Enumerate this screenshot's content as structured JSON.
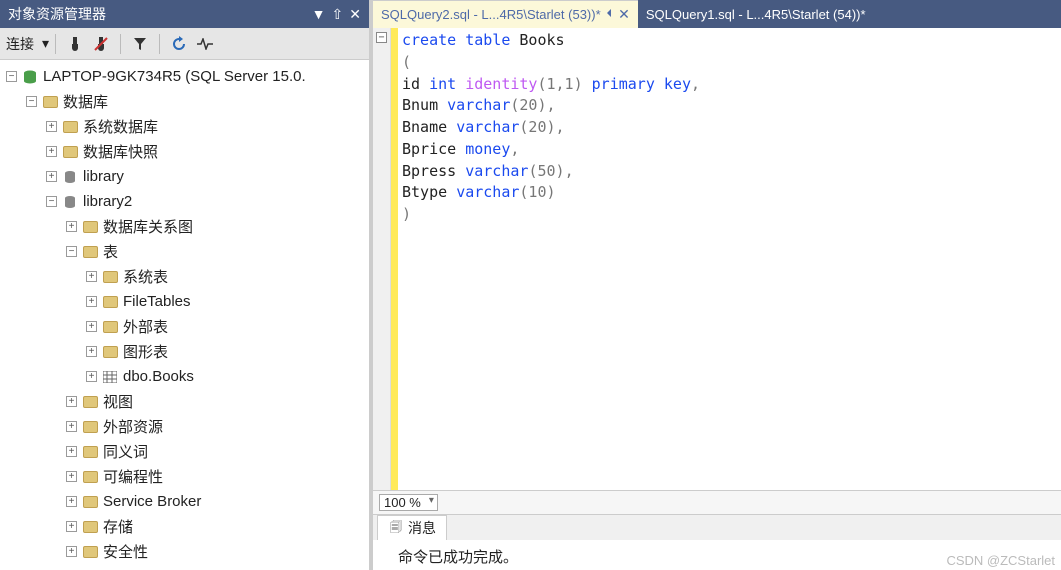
{
  "panel": {
    "title": "对象资源管理器",
    "toolbar_label": "连接"
  },
  "tree": {
    "server": "LAPTOP-9GK734R5 (SQL Server 15.0.",
    "db_group": "数据库",
    "sys_db": "系统数据库",
    "snapshot": "数据库快照",
    "library": "library",
    "library2": "library2",
    "diagrams": "数据库关系图",
    "tables": "表",
    "sys_tables": "系统表",
    "filetables": "FileTables",
    "ext_tables": "外部表",
    "graph_tables": "图形表",
    "dbo_books": "dbo.Books",
    "views": "视图",
    "ext_res": "外部资源",
    "synonyms": "同义词",
    "programmability": "可编程性",
    "service_broker": "Service Broker",
    "storage": "存储",
    "security": "安全性"
  },
  "tabs": [
    {
      "label": "SQLQuery2.sql - L...4R5\\Starlet (53))*",
      "active": true
    },
    {
      "label": "SQLQuery1.sql - L...4R5\\Starlet (54))*",
      "active": false
    }
  ],
  "zoom": "100 %",
  "messages_tab": "消息",
  "messages_body": "命令已成功完成。",
  "watermark": "CSDN @ZCStarlet",
  "code": {
    "l1_kw1": "create",
    "l1_kw2": "table",
    "l1_name": "Books",
    "l2": "(",
    "l3_id": "id",
    "l3_int": "int",
    "l3_iden": "identity",
    "l3_args": "(1,1)",
    "l3_pk1": "primary",
    "l3_pk2": "key",
    "l3_end": ",",
    "l4_c": "Bnum",
    "l4_ty": "varchar",
    "l4_a": "(20)",
    "l4_end": ",",
    "l5_c": "Bname",
    "l5_ty": "varchar",
    "l5_a": "(20)",
    "l5_end": ",",
    "l6_c": "Bprice",
    "l6_ty": "money",
    "l6_end": ",",
    "l7_c": "Bpress",
    "l7_ty": "varchar",
    "l7_a": "(50)",
    "l7_end": ",",
    "l8_c": "Btype",
    "l8_ty": "varchar",
    "l8_a": "(10)",
    "l9": ")"
  }
}
